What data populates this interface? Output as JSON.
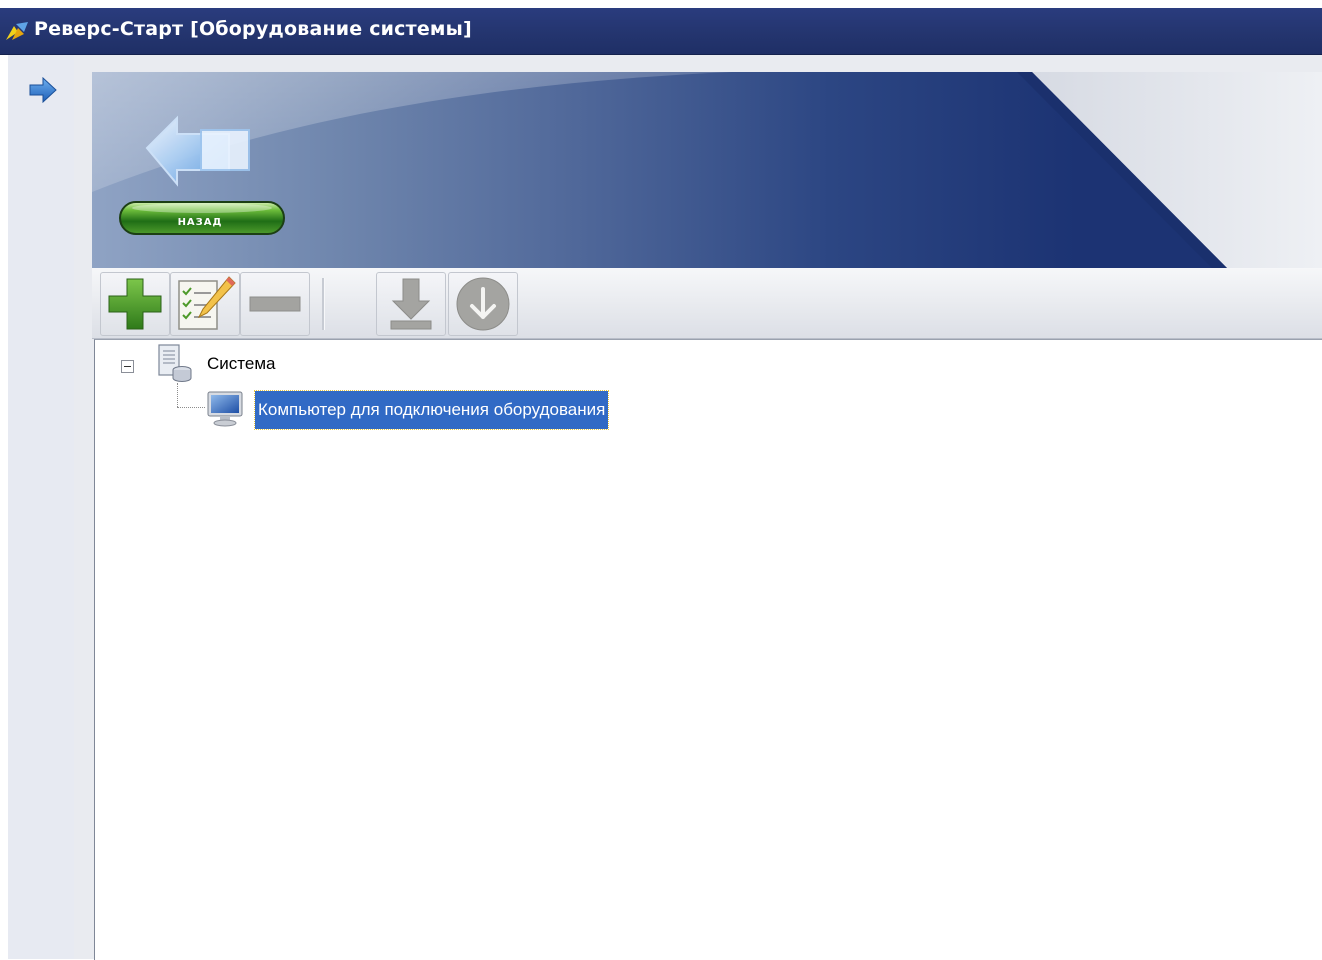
{
  "window": {
    "title": "Реверс-Старт [Оборудование системы]",
    "app_icon": "reverse-start-app-icon"
  },
  "left_panel": {
    "expand_icon": "arrow-right-icon"
  },
  "banner": {
    "back_button_label": "НАЗАД",
    "back_icon": "back-arrow-icon"
  },
  "toolbar": {
    "buttons": [
      {
        "name": "add-button",
        "icon": "plus-icon",
        "enabled": true
      },
      {
        "name": "edit-button",
        "icon": "checklist-pencil-icon",
        "enabled": true
      },
      {
        "name": "remove-button",
        "icon": "minus-icon",
        "enabled": false
      },
      {
        "name": "download-button",
        "icon": "download-arrow-icon",
        "enabled": false
      },
      {
        "name": "install-button",
        "icon": "circle-down-arrow-icon",
        "enabled": false
      }
    ]
  },
  "tree": {
    "root": {
      "label": "Система",
      "icon": "server-database-icon",
      "expanded": true,
      "children": [
        {
          "label": "Компьютер для подключения оборудования",
          "icon": "monitor-icon",
          "selected": true
        }
      ]
    }
  },
  "colors": {
    "titlebar": "#24356f",
    "selection": "#316ac5",
    "add_green": "#4a9a2a",
    "disabled_gray": "#9a9a98"
  }
}
